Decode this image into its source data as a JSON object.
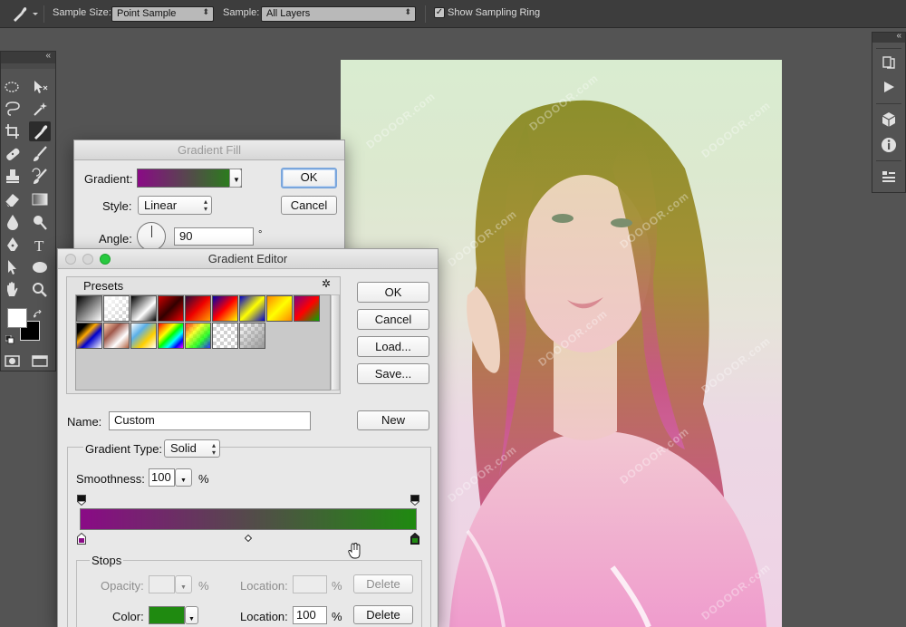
{
  "options_bar": {
    "sample_size_label": "Sample Size:",
    "sample_size_value": "Point Sample",
    "sample_label": "Sample:",
    "sample_value": "All Layers",
    "show_sampling_ring_label": "Show Sampling Ring",
    "show_sampling_ring_checked": "✓"
  },
  "toolbar": {
    "collapse_glyph": "«",
    "tools": [
      "marquee-tool",
      "move-tool",
      "lasso-tool",
      "magic-wand-tool",
      "crop-tool",
      "eyedropper-tool",
      "healing-brush-tool",
      "brush-tool",
      "clone-stamp-tool",
      "history-brush-tool",
      "eraser-tool",
      "gradient-tool",
      "blur-tool",
      "dodge-tool",
      "pen-tool",
      "type-tool",
      "path-selection-tool",
      "shape-tool",
      "hand-tool",
      "zoom-tool"
    ],
    "active_tool": "eyedropper-tool",
    "foreground_color": "#ffffff",
    "background_color": "#000000"
  },
  "right_panel": {
    "collapse_glyph": "«"
  },
  "canvas": {
    "watermark": "DOOOOR.com"
  },
  "gradient_fill": {
    "title": "Gradient Fill",
    "gradient_label": "Gradient:",
    "style_label": "Style:",
    "style_value": "Linear",
    "angle_label": "Angle:",
    "angle_value": "90",
    "angle_unit": "°",
    "ok_label": "OK",
    "cancel_label": "Cancel"
  },
  "gradient_editor": {
    "title": "Gradient Editor",
    "presets_label": "Presets",
    "gear_glyph": "✲",
    "ok_label": "OK",
    "cancel_label": "Cancel",
    "load_label": "Load...",
    "save_label": "Save...",
    "name_label": "Name:",
    "name_value": "Custom",
    "new_label": "New",
    "gradient_type_label": "Gradient Type:",
    "gradient_type_value": "Solid",
    "smoothness_label": "Smoothness:",
    "smoothness_value": "100",
    "smoothness_unit": "%",
    "stops_label": "Stops",
    "opacity_label": "Opacity:",
    "opacity_value": "",
    "opacity_unit": "%",
    "opacity_location_label": "Location:",
    "opacity_location_value": "",
    "opacity_location_unit": "%",
    "opacity_delete_label": "Delete",
    "color_label": "Color:",
    "color_value": "#1f8a10",
    "color_location_label": "Location:",
    "color_location_value": "100",
    "color_location_unit": "%",
    "color_delete_label": "Delete",
    "gradient_start_color": "#8a0a86",
    "gradient_end_color": "#1f8a10",
    "selected_stop_color": "#1f8a10",
    "start_stop_color": "#8a0a86"
  }
}
